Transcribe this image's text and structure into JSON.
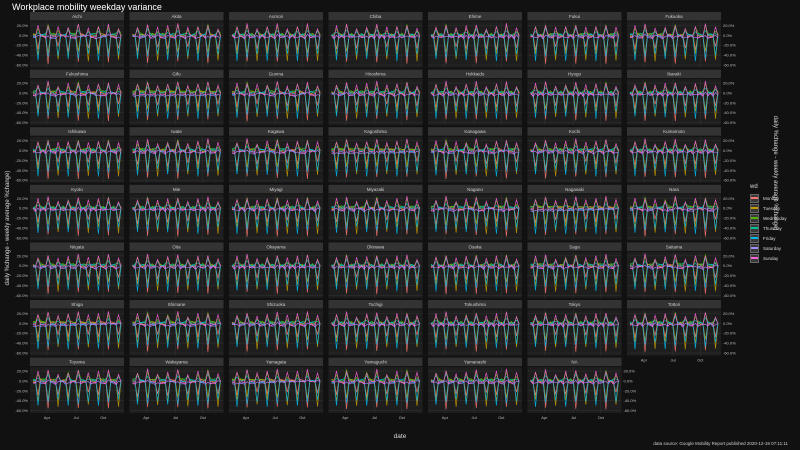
{
  "chart_data": {
    "type": "line",
    "title": "Workplace mobility weekday variance",
    "xlabel": "date",
    "ylabel": "daily %change - weekly average %change)",
    "caption": "data source: Google Mobility Report published 2020-12-19 07:11:11",
    "legend_title": "wd",
    "legend_position": "right",
    "grid": true,
    "ylim": [
      -65,
      28
    ],
    "y_ticks": [
      "20.0%",
      "0.0%",
      "-20.0%",
      "-40.0%",
      "-60.0%"
    ],
    "y_tick_values": [
      20,
      0,
      -20,
      -40,
      -60
    ],
    "x_ticks": [
      "Apr",
      "Jul",
      "Oct"
    ],
    "x_tick_positions": [
      0.18,
      0.49,
      0.78
    ],
    "series": [
      {
        "name": "Monday",
        "color": "#f8766d",
        "values": [
          0,
          -1,
          -30,
          2,
          0,
          -1,
          -55,
          1,
          0,
          -2,
          -25,
          0
        ]
      },
      {
        "name": "Tuesday",
        "color": "#c49a00",
        "values": [
          1,
          0,
          -40,
          1,
          0,
          0,
          -35,
          0,
          1,
          0,
          -50,
          1
        ]
      },
      {
        "name": "Wednesday",
        "color": "#53b400",
        "values": [
          2,
          1,
          15,
          3,
          2,
          1,
          20,
          2,
          2,
          1,
          10,
          2
        ]
      },
      {
        "name": "Thursday",
        "color": "#00c094",
        "values": [
          1,
          2,
          8,
          1,
          1,
          2,
          12,
          1,
          1,
          2,
          6,
          1
        ]
      },
      {
        "name": "Friday",
        "color": "#00b6eb",
        "values": [
          0,
          -1,
          -50,
          0,
          0,
          -1,
          -45,
          0,
          0,
          -1,
          -40,
          0
        ]
      },
      {
        "name": "Saturday",
        "color": "#a58aff",
        "values": [
          -3,
          -5,
          -2,
          -4,
          -3,
          -5,
          0,
          -4,
          -3,
          -5,
          -1,
          -4
        ]
      },
      {
        "name": "Sunday",
        "color": "#fb61d7",
        "values": [
          -2,
          -4,
          18,
          -3,
          -2,
          -4,
          22,
          -3,
          -2,
          -4,
          15,
          -3
        ]
      }
    ],
    "panels": [
      "Aichi",
      "Akita",
      "Aomori",
      "Chiba",
      "Ehime",
      "Fukui",
      "Fukuoka",
      "Fukushima",
      "Gifu",
      "Gunma",
      "Hiroshima",
      "Hokkaido",
      "Hyogo",
      "Ibaraki",
      "Ishikawa",
      "Iwate",
      "Kagawa",
      "Kagoshima",
      "Kanagawa",
      "Kochi",
      "Kumamoto",
      "Kyoto",
      "Mie",
      "Miyagi",
      "Miyazaki",
      "Nagano",
      "Nagasaki",
      "Nara",
      "Niigata",
      "Oita",
      "Okayama",
      "Okinawa",
      "Osaka",
      "Saga",
      "Saitama",
      "Shiga",
      "Shimane",
      "Shizuoka",
      "Tochigi",
      "Tokushima",
      "Tokyo",
      "Tottori",
      "Toyama",
      "Wakayama",
      "Yamagata",
      "Yamaguchi",
      "Yamanashi",
      "NA"
    ]
  }
}
